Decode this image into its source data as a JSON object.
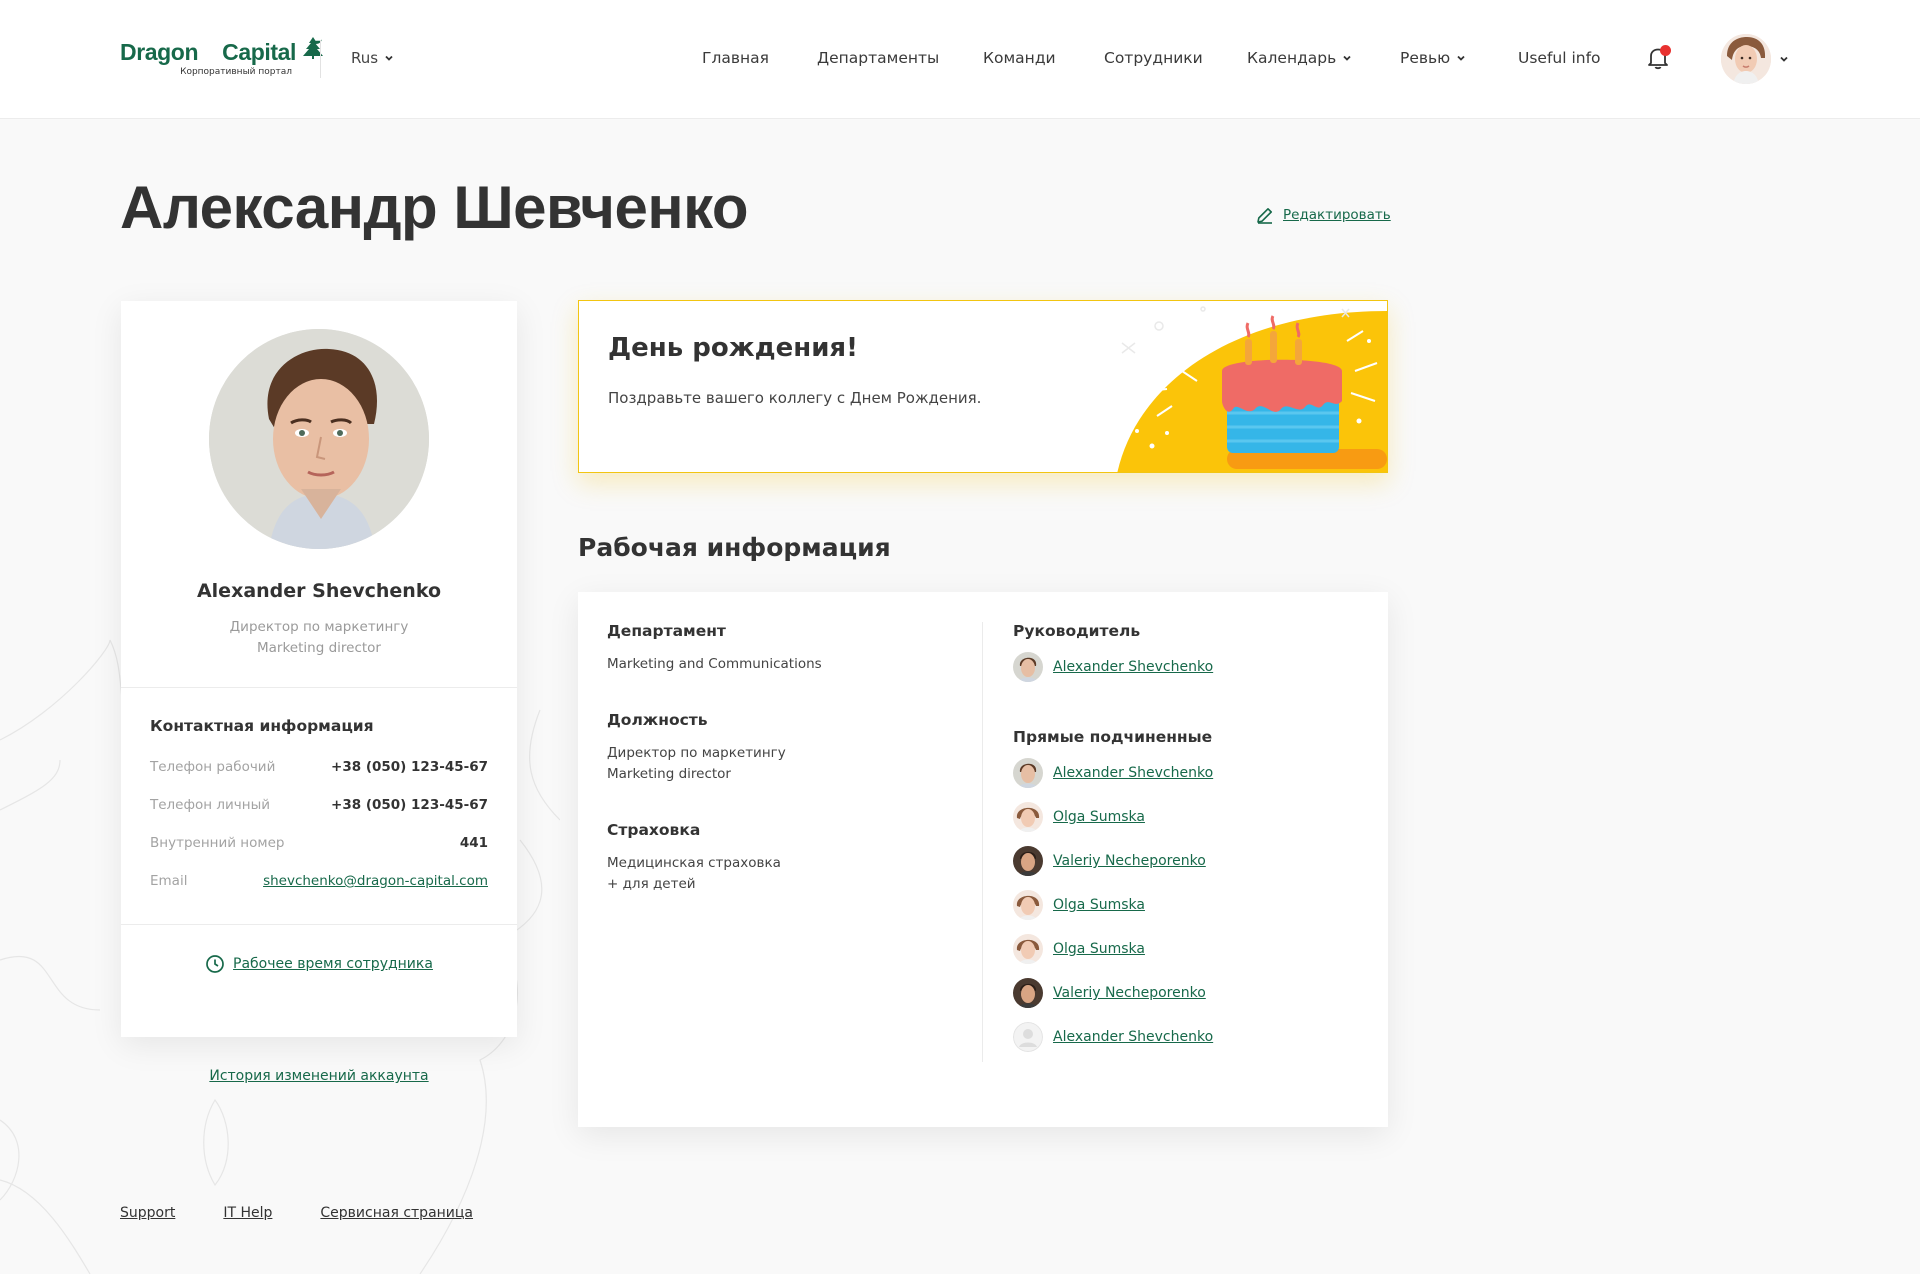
{
  "header": {
    "logo_title_left": "Dragon",
    "logo_title_right": "Capital",
    "logo_subtitle": "Корпоративный портал",
    "language": "Rus",
    "nav": [
      "Главная",
      "Департаменты",
      "Команди",
      "Сотрудники",
      "Календарь",
      "Ревью",
      "Useful info"
    ],
    "notifications_has_unread": true
  },
  "page": {
    "title": "Александр Шевченко",
    "edit_label": "Редактировать"
  },
  "profile": {
    "name": "Alexander Shevchenko",
    "title_ru": "Директор по маркетингу",
    "title_en": "Marketing director",
    "contact_heading": "Контактная информация",
    "contacts": [
      {
        "label": "Телефон рабочий",
        "value": "+38 (050) 123-45-67"
      },
      {
        "label": "Телефон личный",
        "value": "+38 (050) 123-45-67"
      },
      {
        "label": "Внутренний номер",
        "value": "441"
      },
      {
        "label": "Email",
        "value": "shevchenko@dragon-capital.com"
      }
    ],
    "worktime_label": "Рабочее время сотрудника",
    "history_label": "История изменений аккаунта"
  },
  "birthday": {
    "title": "День рождения!",
    "text": "Поздравьте вашего коллегу с Днем Рождения."
  },
  "work": {
    "section_title": "Рабочая информация",
    "department_label": "Департамент",
    "department_value": "Marketing and Communications",
    "position_label": "Должность",
    "position_ru": "Директор по маркетингу",
    "position_en": "Marketing director",
    "insurance_label": "Страховка",
    "insurance_line1": "Медицинская страховка",
    "insurance_line2": "+ для детей",
    "manager_label": "Руководитель",
    "manager_name": "Alexander Shevchenko",
    "reports_label": "Прямые подчиненные",
    "reports": [
      "Alexander Shevchenko",
      "Olga Sumska",
      "Valeriy Necheporenko",
      "Olga Sumska",
      "Olga Sumska",
      "Valeriy Necheporenko",
      "Alexander Shevchenko"
    ]
  },
  "footer": {
    "links": [
      "Support",
      "IT Help",
      "Сервисная страница"
    ]
  },
  "colors": {
    "brand_green": "#17694a",
    "accent_yellow": "#fbc409",
    "notification_red": "#e8312f"
  },
  "icons": [
    "chevron-down-icon",
    "bell-icon",
    "pencil-icon",
    "clock-icon",
    "birthday-cake-icon"
  ]
}
